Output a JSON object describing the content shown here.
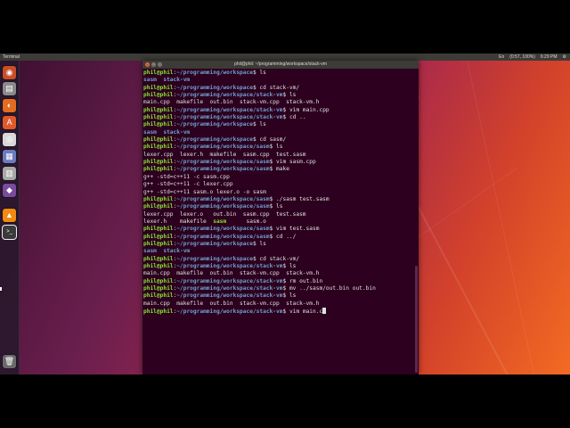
{
  "topbar": {
    "title": "Terminal",
    "indicators": [
      "En",
      "(0:57, 100%)",
      "6:29 PM",
      "⚙"
    ]
  },
  "window": {
    "title": "phil@phil: ~/programming/workspace/stack-vm"
  },
  "launcher": {
    "items": [
      {
        "name": "dash-icon",
        "glyph": "◉",
        "color": "#c84e2a"
      },
      {
        "name": "files-icon",
        "glyph": "▤",
        "color": "#8a8a8a"
      },
      {
        "name": "firefox-icon",
        "glyph": "◐",
        "color": "#e36c1f"
      },
      {
        "name": "software-center-icon",
        "glyph": "A",
        "color": "#e0592a"
      },
      {
        "name": "chrome-icon",
        "glyph": "◎",
        "color": "#d8d8d8"
      },
      {
        "name": "libreoffice-icon",
        "glyph": "▦",
        "color": "#6c7bbf"
      },
      {
        "name": "disks-icon",
        "glyph": "▥",
        "color": "#a8a8a8"
      },
      {
        "name": "app-icon",
        "glyph": "◆",
        "color": "#7a4aa0"
      },
      {
        "name": "vlc-icon",
        "glyph": "▲",
        "color": "#f08a10"
      },
      {
        "name": "terminal-icon",
        "glyph": ">_",
        "color": "#3a3a3a",
        "active": true
      },
      {
        "name": "trash-icon",
        "glyph": "🗑",
        "color": "#6a6a6a"
      }
    ]
  },
  "prompt": {
    "user": "phil@phil",
    "sep": ":",
    "paths": {
      "ws": "~/programming/workspace",
      "vm": "~/programming/workspace/stack-vm",
      "sasm": "~/programming/workspace/sasm"
    },
    "end": "$ "
  },
  "terminal": {
    "lines": [
      {
        "type": "prompt",
        "path": "ws",
        "cmd": "ls"
      },
      {
        "type": "output",
        "parts": [
          {
            "t": "sasm",
            "c": "dir"
          },
          {
            "t": "  "
          },
          {
            "t": "stack-vm",
            "c": "dir"
          }
        ]
      },
      {
        "type": "prompt",
        "path": "ws",
        "cmd": "cd stack-vm/"
      },
      {
        "type": "prompt",
        "path": "vm",
        "cmd": "ls"
      },
      {
        "type": "output",
        "parts": [
          {
            "t": "main.cpp  makefile  out.bin  stack-vm.cpp  stack-vm.h"
          }
        ]
      },
      {
        "type": "prompt",
        "path": "vm",
        "cmd": "vim main.cpp"
      },
      {
        "type": "prompt",
        "path": "vm",
        "cmd": "cd .."
      },
      {
        "type": "prompt",
        "path": "ws",
        "cmd": "ls"
      },
      {
        "type": "output",
        "parts": [
          {
            "t": "sasm",
            "c": "dir"
          },
          {
            "t": "  "
          },
          {
            "t": "stack-vm",
            "c": "dir"
          }
        ]
      },
      {
        "type": "prompt",
        "path": "ws",
        "cmd": "cd sasm/"
      },
      {
        "type": "prompt",
        "path": "sasm",
        "cmd": "ls"
      },
      {
        "type": "output",
        "parts": [
          {
            "t": "lexer.cpp  lexer.h  makefile  sasm.cpp  test.sasm"
          }
        ]
      },
      {
        "type": "prompt",
        "path": "sasm",
        "cmd": "vim sasm.cpp"
      },
      {
        "type": "prompt",
        "path": "sasm",
        "cmd": "make"
      },
      {
        "type": "output",
        "parts": [
          {
            "t": "g++ -std=c++11 -c sasm.cpp"
          }
        ]
      },
      {
        "type": "output",
        "parts": [
          {
            "t": "g++ -std=c++11 -c lexer.cpp"
          }
        ]
      },
      {
        "type": "output",
        "parts": [
          {
            "t": "g++ -std=c++11 sasm.o lexer.o -o sasm"
          }
        ]
      },
      {
        "type": "prompt",
        "path": "sasm",
        "cmd": "./sasm test.sasm"
      },
      {
        "type": "prompt",
        "path": "sasm",
        "cmd": "ls"
      },
      {
        "type": "output",
        "parts": [
          {
            "t": "lexer.cpp  lexer.o   out.bin  sasm.cpp  test.sasm"
          }
        ]
      },
      {
        "type": "output",
        "parts": [
          {
            "t": "lexer.h    makefile  "
          },
          {
            "t": "sasm",
            "c": "exe"
          },
          {
            "t": "      sasm.o"
          }
        ]
      },
      {
        "type": "prompt",
        "path": "sasm",
        "cmd": "vim test.sasm"
      },
      {
        "type": "prompt",
        "path": "sasm",
        "cmd": "cd ../"
      },
      {
        "type": "prompt",
        "path": "ws",
        "cmd": "ls"
      },
      {
        "type": "output",
        "parts": [
          {
            "t": "sasm",
            "c": "dir"
          },
          {
            "t": "  "
          },
          {
            "t": "stack-vm",
            "c": "dir"
          }
        ]
      },
      {
        "type": "prompt",
        "path": "ws",
        "cmd": "cd stack-vm/"
      },
      {
        "type": "prompt",
        "path": "vm",
        "cmd": "ls"
      },
      {
        "type": "output",
        "parts": [
          {
            "t": "main.cpp  makefile  out.bin  stack-vm.cpp  stack-vm.h"
          }
        ]
      },
      {
        "type": "prompt",
        "path": "vm",
        "cmd": "rm out.bin"
      },
      {
        "type": "prompt",
        "path": "vm",
        "cmd": "mv ../sasm/out.bin out.bin"
      },
      {
        "type": "prompt",
        "path": "vm",
        "cmd": "ls"
      },
      {
        "type": "output",
        "parts": [
          {
            "t": "main.cpp  makefile  out.bin  stack-vm.cpp  stack-vm.h"
          }
        ]
      },
      {
        "type": "prompt",
        "path": "vm",
        "cmd": "vim main.c",
        "cursor": true
      }
    ]
  }
}
